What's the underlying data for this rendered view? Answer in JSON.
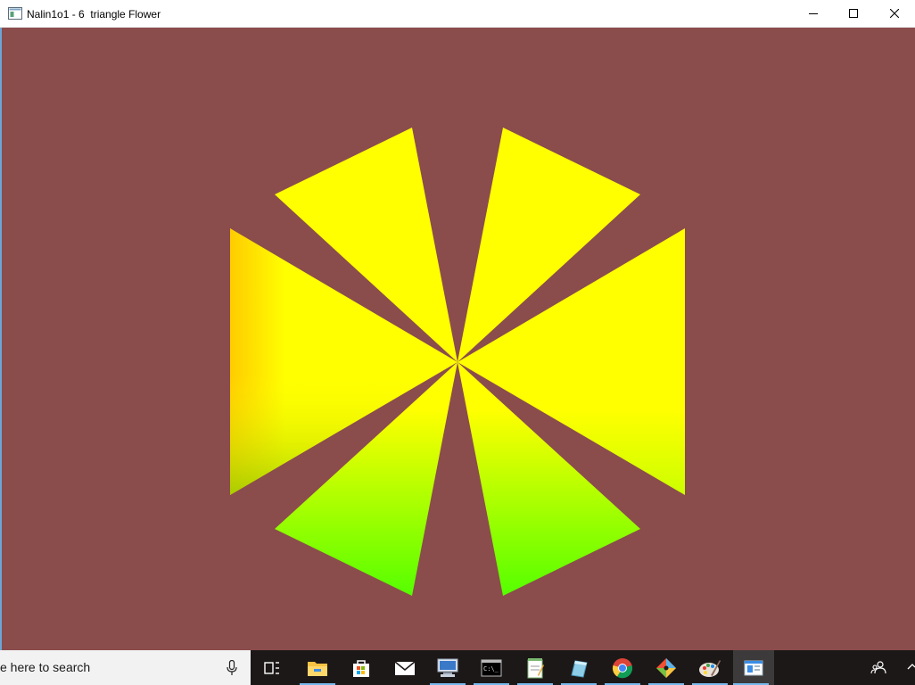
{
  "window": {
    "title": "Nalin1o1 - 6  triangle Flower",
    "background_color": "#8b4c4c",
    "icons": {
      "app": "window-app-icon",
      "minimize": "minimize-icon",
      "maximize": "maximize-icon",
      "close": "close-icon"
    }
  },
  "scene": {
    "triangle_count": 6,
    "colors": {
      "yellow": "#ffff00",
      "green": "#55ff00",
      "orange": "#ffcc00",
      "olive": "#c8c800"
    }
  },
  "taskbar": {
    "search_placeholder": "e here to search",
    "items": [
      {
        "name": "task-view-icon"
      },
      {
        "name": "file-explorer-icon"
      },
      {
        "name": "microsoft-store-icon"
      },
      {
        "name": "mail-icon"
      },
      {
        "name": "remote-desktop-icon"
      },
      {
        "name": "command-prompt-icon"
      },
      {
        "name": "notepad-icon"
      },
      {
        "name": "app-icon"
      },
      {
        "name": "chrome-icon"
      },
      {
        "name": "git-icon"
      },
      {
        "name": "paint-icon"
      },
      {
        "name": "opengl-window-icon"
      }
    ],
    "tray": {
      "people": "people-icon",
      "chevron": "show-hidden-icons-icon"
    }
  }
}
